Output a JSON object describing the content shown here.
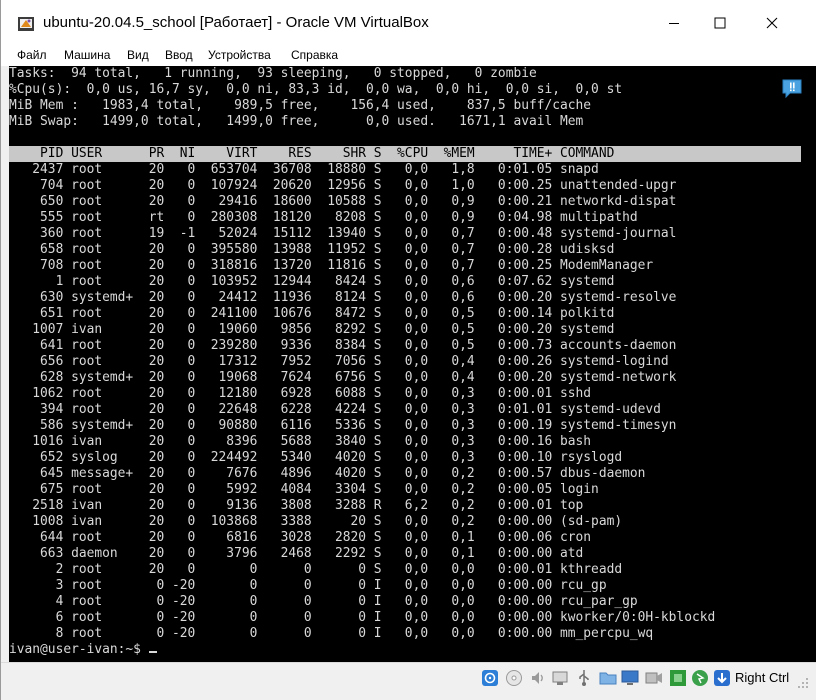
{
  "window": {
    "title": "ubuntu-20.04.5_school [Работает] - Oracle VM VirtualBox",
    "controls": [
      "minimize-icon",
      "maximize-icon",
      "close-icon"
    ]
  },
  "menu": [
    "Файл",
    "Машина",
    "Вид",
    "Ввод",
    "Устройства",
    "Справка"
  ],
  "terminal": {
    "summary": [
      "Tasks:  94 total,   1 running,  93 sleeping,   0 stopped,   0 zombie",
      "%Cpu(s):  0,0 us, 16,7 sy,  0,0 ni, 83,3 id,  0,0 wa,  0,0 hi,  0,0 si,  0,0 st",
      "MiB Mem :   1983,4 total,    989,5 free,    156,4 used,    837,5 buff/cache",
      "MiB Swap:   1499,0 total,   1499,0 free,      0,0 used.   1671,1 avail Mem"
    ],
    "header": "    PID USER      PR  NI    VIRT    RES    SHR S  %CPU  %MEM     TIME+ COMMAND",
    "processes": [
      "   2437 root      20   0  653704  36708  18880 S   0,0   1,8   0:01.05 snapd",
      "    704 root      20   0  107924  20620  12956 S   0,0   1,0   0:00.25 unattended-upgr",
      "    650 root      20   0   29416  18600  10588 S   0,0   0,9   0:00.21 networkd-dispat",
      "    555 root      rt   0  280308  18120   8208 S   0,0   0,9   0:04.98 multipathd",
      "    360 root      19  -1   52024  15112  13940 S   0,0   0,7   0:00.48 systemd-journal",
      "    658 root      20   0  395580  13988  11952 S   0,0   0,7   0:00.28 udisksd",
      "    708 root      20   0  318816  13720  11816 S   0,0   0,7   0:00.25 ModemManager",
      "      1 root      20   0  103952  12944   8424 S   0,0   0,6   0:07.62 systemd",
      "    630 systemd+  20   0   24412  11936   8124 S   0,0   0,6   0:00.20 systemd-resolve",
      "    651 root      20   0  241100  10676   8472 S   0,0   0,5   0:00.14 polkitd",
      "   1007 ivan      20   0   19060   9856   8292 S   0,0   0,5   0:00.20 systemd",
      "    641 root      20   0  239280   9336   8384 S   0,0   0,5   0:00.73 accounts-daemon",
      "    656 root      20   0   17312   7952   7056 S   0,0   0,4   0:00.26 systemd-logind",
      "    628 systemd+  20   0   19068   7624   6756 S   0,0   0,4   0:00.20 systemd-network",
      "   1062 root      20   0   12180   6928   6088 S   0,0   0,3   0:00.01 sshd",
      "    394 root      20   0   22648   6228   4224 S   0,0   0,3   0:01.01 systemd-udevd",
      "    586 systemd+  20   0   90880   6116   5336 S   0,0   0,3   0:00.19 systemd-timesyn",
      "   1016 ivan      20   0    8396   5688   3840 S   0,0   0,3   0:00.16 bash",
      "    652 syslog    20   0  224492   5340   4020 S   0,0   0,3   0:00.10 rsyslogd",
      "    645 message+  20   0    7676   4896   4020 S   0,0   0,2   0:00.57 dbus-daemon",
      "    675 root      20   0    5992   4084   3304 S   0,0   0,2   0:00.05 login",
      "   2518 ivan      20   0    9136   3808   3288 R   6,2   0,2   0:00.01 top",
      "   1008 ivan      20   0  103868   3388     20 S   0,0   0,2   0:00.00 (sd-pam)",
      "    644 root      20   0    6816   3028   2820 S   0,0   0,1   0:00.06 cron",
      "    663 daemon    20   0    3796   2468   2292 S   0,0   0,1   0:00.00 atd",
      "      2 root      20   0       0      0      0 S   0,0   0,0   0:00.01 kthreadd",
      "      3 root       0 -20       0      0      0 I   0,0   0,0   0:00.00 rcu_gp",
      "      4 root       0 -20       0      0      0 I   0,0   0,0   0:00.00 rcu_par_gp",
      "      6 root       0 -20       0      0      0 I   0,0   0,0   0:00.00 kworker/0:0H-kblockd",
      "      8 root       0 -20       0      0      0 I   0,0   0,0   0:00.00 mm_percpu_wq"
    ],
    "prompt": "ivan@user-ivan:~$ "
  },
  "statusbar": {
    "icons": [
      "hard-disk-icon",
      "optical-drive-icon",
      "audio-icon",
      "network-icon",
      "usb-icon",
      "shared-folders-icon",
      "display-icon",
      "video-capture-icon",
      "cpu-icon",
      "mouse-integration-icon",
      "keyboard-capture-icon"
    ],
    "host_key": "Right Ctrl"
  },
  "colors": {
    "terminal_bg": "#000000",
    "terminal_fg": "#d9d9d9",
    "header_bg": "#c8c8c8",
    "chrome_bg": "#f0f0f0"
  }
}
